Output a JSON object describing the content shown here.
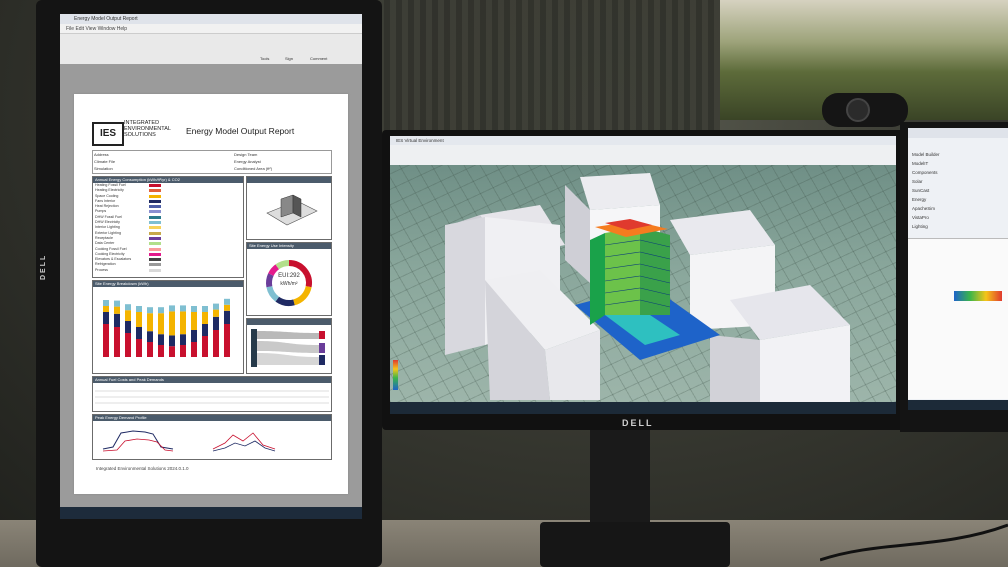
{
  "left_monitor": {
    "window_title": "Energy Model Output Report",
    "menu": "File  Edit  View  Window  Help",
    "tool_tabs": [
      "Tools",
      "Sign",
      "Comment"
    ],
    "report": {
      "logo_mark": "IES",
      "logo_lines": [
        "INTEGRATED",
        "ENVIRONMENTAL",
        "SOLUTIONS"
      ],
      "title": "Energy Model Output Report",
      "info_labels": [
        "Address",
        "Climate File",
        "Simulation"
      ],
      "info_labels_right": [
        "Design Team",
        "Energy Analyst",
        "Conditioned Area (ft²)"
      ],
      "section_annual": "Annual Energy Consumption (kWh/ft²/yr) & CO2",
      "section_site_eui": "Site Energy Use Intensity",
      "eui_value": "EUI:292",
      "eui_unit": "kWh/m²",
      "section_monthly": "Site Energy Breakdown (kWh)",
      "section_fuel": "Annual Fuel Costs and Peak Demands",
      "section_peak": "Peak Energy Demand Profile",
      "footer": "Integrated Environmental Solutions 2024.0.1.0",
      "energy_categories": [
        {
          "label": "Heating Fossil Fuel",
          "color": "#c8102e"
        },
        {
          "label": "Heating Electricity",
          "color": "#e2603a"
        },
        {
          "label": "Space Cooling",
          "color": "#f4b400"
        },
        {
          "label": "Fans Interior",
          "color": "#1f2a63"
        },
        {
          "label": "Heat Rejection",
          "color": "#4e5fa8"
        },
        {
          "label": "Pumps",
          "color": "#8a8fd0"
        },
        {
          "label": "DHW Fossil Fuel",
          "color": "#2b7a8c"
        },
        {
          "label": "DHW Electricity",
          "color": "#7fbfd1"
        },
        {
          "label": "Interior Lighting",
          "color": "#f7d259"
        },
        {
          "label": "Exterior Lighting",
          "color": "#c7a94a"
        },
        {
          "label": "Receptacle",
          "color": "#6a3d9a"
        },
        {
          "label": "Data Center",
          "color": "#b2df8a"
        },
        {
          "label": "Cooking Fossil Fuel",
          "color": "#fb9a99"
        },
        {
          "label": "Cooking Electricity",
          "color": "#e31a8c"
        },
        {
          "label": "Elevators & Escalators",
          "color": "#444444"
        },
        {
          "label": "Refrigeration",
          "color": "#999999"
        },
        {
          "label": "Process",
          "color": "#d9d9d9"
        }
      ],
      "monthly_bars": [
        [
          0.55,
          0.2,
          0.1,
          0.1
        ],
        [
          0.5,
          0.22,
          0.12,
          0.1
        ],
        [
          0.4,
          0.2,
          0.18,
          0.1
        ],
        [
          0.3,
          0.2,
          0.25,
          0.1
        ],
        [
          0.25,
          0.18,
          0.3,
          0.1
        ],
        [
          0.2,
          0.18,
          0.35,
          0.1
        ],
        [
          0.18,
          0.18,
          0.4,
          0.1
        ],
        [
          0.2,
          0.18,
          0.38,
          0.1
        ],
        [
          0.25,
          0.2,
          0.3,
          0.1
        ],
        [
          0.35,
          0.2,
          0.2,
          0.1
        ],
        [
          0.45,
          0.22,
          0.12,
          0.1
        ],
        [
          0.55,
          0.22,
          0.1,
          0.1
        ]
      ],
      "donut_segments": [
        {
          "value": 0.28,
          "color": "#c8102e"
        },
        {
          "value": 0.18,
          "color": "#f4b400"
        },
        {
          "value": 0.14,
          "color": "#1f2a63"
        },
        {
          "value": 0.12,
          "color": "#7fbfd1"
        },
        {
          "value": 0.1,
          "color": "#6a3d9a"
        },
        {
          "value": 0.08,
          "color": "#e31a8c"
        },
        {
          "value": 0.1,
          "color": "#b2df8a"
        }
      ]
    }
  },
  "center_monitor": {
    "brand": "DELL",
    "window_title": "IES Virtual Environment"
  },
  "right_monitor": {
    "side_items": [
      "Model Builder",
      "ModelIT",
      "Components",
      "Solar",
      "SunCast",
      "Energy",
      "ApacheSim",
      "VistaPro",
      "Lighting"
    ]
  },
  "left_brand": "DELL"
}
